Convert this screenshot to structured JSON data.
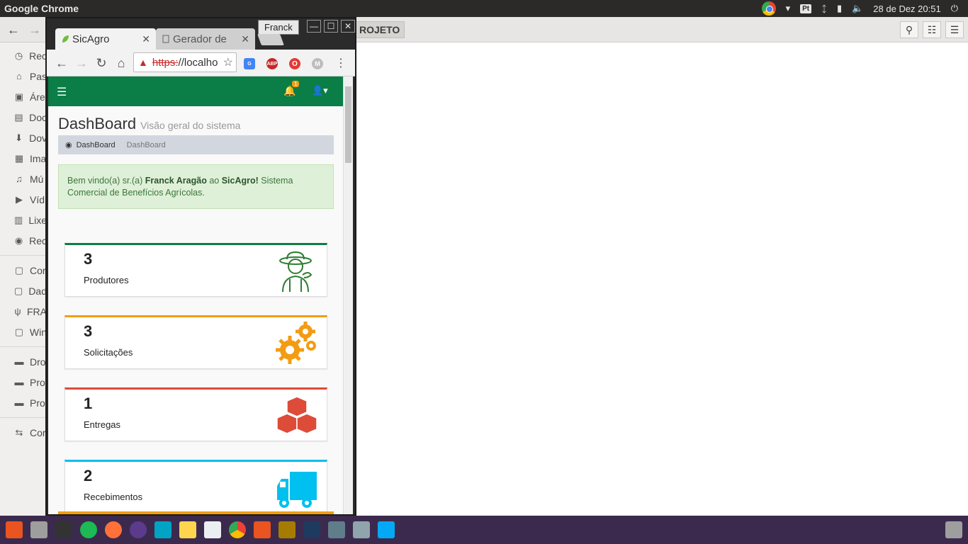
{
  "topbar": {
    "app_title": "Google Chrome",
    "lang": "Pt",
    "datetime": "28 de Dez 20:51"
  },
  "files": {
    "path_segment": "ROJETO",
    "sidebar": [
      {
        "icon": "clock-icon",
        "label": "Rec"
      },
      {
        "icon": "home-icon",
        "label": "Pas"
      },
      {
        "icon": "desktop-icon",
        "label": "Áre"
      },
      {
        "icon": "document-icon",
        "label": "Doc"
      },
      {
        "icon": "download-icon",
        "label": "Dov"
      },
      {
        "icon": "image-icon",
        "label": "Ima"
      },
      {
        "icon": "music-icon",
        "label": "Mú"
      },
      {
        "icon": "video-icon",
        "label": "Víd"
      },
      {
        "icon": "trash-icon",
        "label": "Lixe"
      },
      {
        "icon": "network-icon",
        "label": "Rec"
      },
      {
        "icon": "drive-icon",
        "label": "Cor"
      },
      {
        "icon": "drive-icon",
        "label": "Dad"
      },
      {
        "icon": "usb-icon",
        "label": "FRA"
      },
      {
        "icon": "drive-icon",
        "label": "Win"
      },
      {
        "icon": "folder-icon",
        "label": "Dro"
      },
      {
        "icon": "folder-icon",
        "label": "Pro"
      },
      {
        "icon": "folder-icon",
        "label": "Pro"
      },
      {
        "icon": "connect-icon",
        "label": "Cor"
      }
    ]
  },
  "chrome": {
    "profile": "Franck",
    "tabs": [
      {
        "title": "SicAgro"
      },
      {
        "title": "Gerador de"
      }
    ],
    "url_scheme": "https:",
    "url_rest": "//localho"
  },
  "sicagro": {
    "notification_count": "1",
    "page_title": "DashBoard",
    "page_subtitle": "Visão geral do sistema",
    "breadcrumb": [
      "DashBoard",
      "DashBoard"
    ],
    "welcome": {
      "prefix": "Bem vindo(a) sr.(a) ",
      "user": "Franck Aragão",
      "middle": " ao ",
      "app": "SicAgro!",
      "suffix": " Sistema Comercial de Benefícios Agrícolas."
    },
    "cards": [
      {
        "value": "3",
        "label": "Produtores",
        "color": "#0a7e46",
        "icon": "farmer-icon"
      },
      {
        "value": "3",
        "label": "Solicitações",
        "color": "#f39c12",
        "icon": "gears-icon"
      },
      {
        "value": "1",
        "label": "Entregas",
        "color": "#dd4b39",
        "icon": "boxes-icon"
      },
      {
        "value": "2",
        "label": "Recebimentos",
        "color": "#00c0ef",
        "icon": "truck-icon"
      }
    ]
  }
}
